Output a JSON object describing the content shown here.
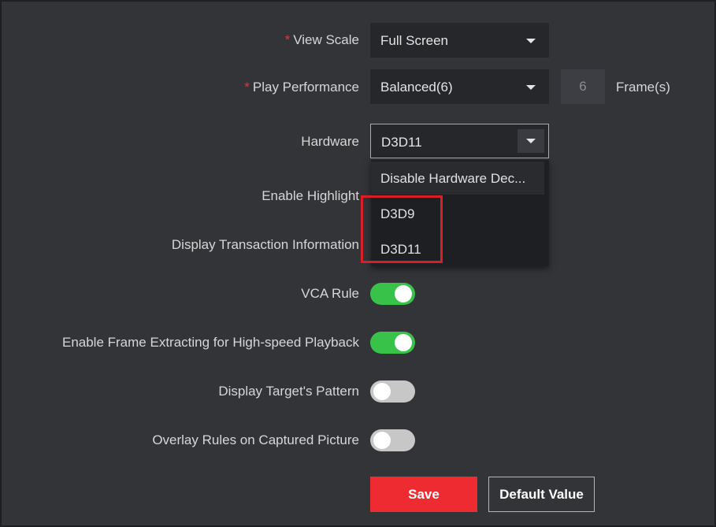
{
  "settings": {
    "view_scale": {
      "label": "View Scale",
      "required_mark": "*",
      "value": "Full Screen"
    },
    "play_performance": {
      "label": "Play Performance",
      "required_mark": "*",
      "value": "Balanced(6)",
      "frames_value": "6",
      "frames_unit": "Frame(s)"
    },
    "hardware": {
      "label": "Hardware",
      "value": "D3D11",
      "options": [
        "Disable Hardware Dec...",
        "D3D9",
        "D3D11"
      ]
    },
    "enable_highlight": {
      "label": "Enable Highlight"
    },
    "display_transaction": {
      "label": "Display Transaction Information"
    },
    "vca_rule": {
      "label": "VCA Rule",
      "on": true
    },
    "frame_extracting": {
      "label": "Enable Frame Extracting for High-speed Playback",
      "on": true
    },
    "target_pattern": {
      "label": "Display Target's Pattern",
      "on": false
    },
    "overlay_rules": {
      "label": "Overlay Rules on Captured Picture",
      "on": false
    }
  },
  "buttons": {
    "save": "Save",
    "default_value": "Default Value"
  },
  "colors": {
    "background": "#333438",
    "accent_red": "#ee2b31",
    "toggle_on": "#39c24a",
    "toggle_off": "#c7c7c7",
    "highlight_box": "#d81e28"
  }
}
